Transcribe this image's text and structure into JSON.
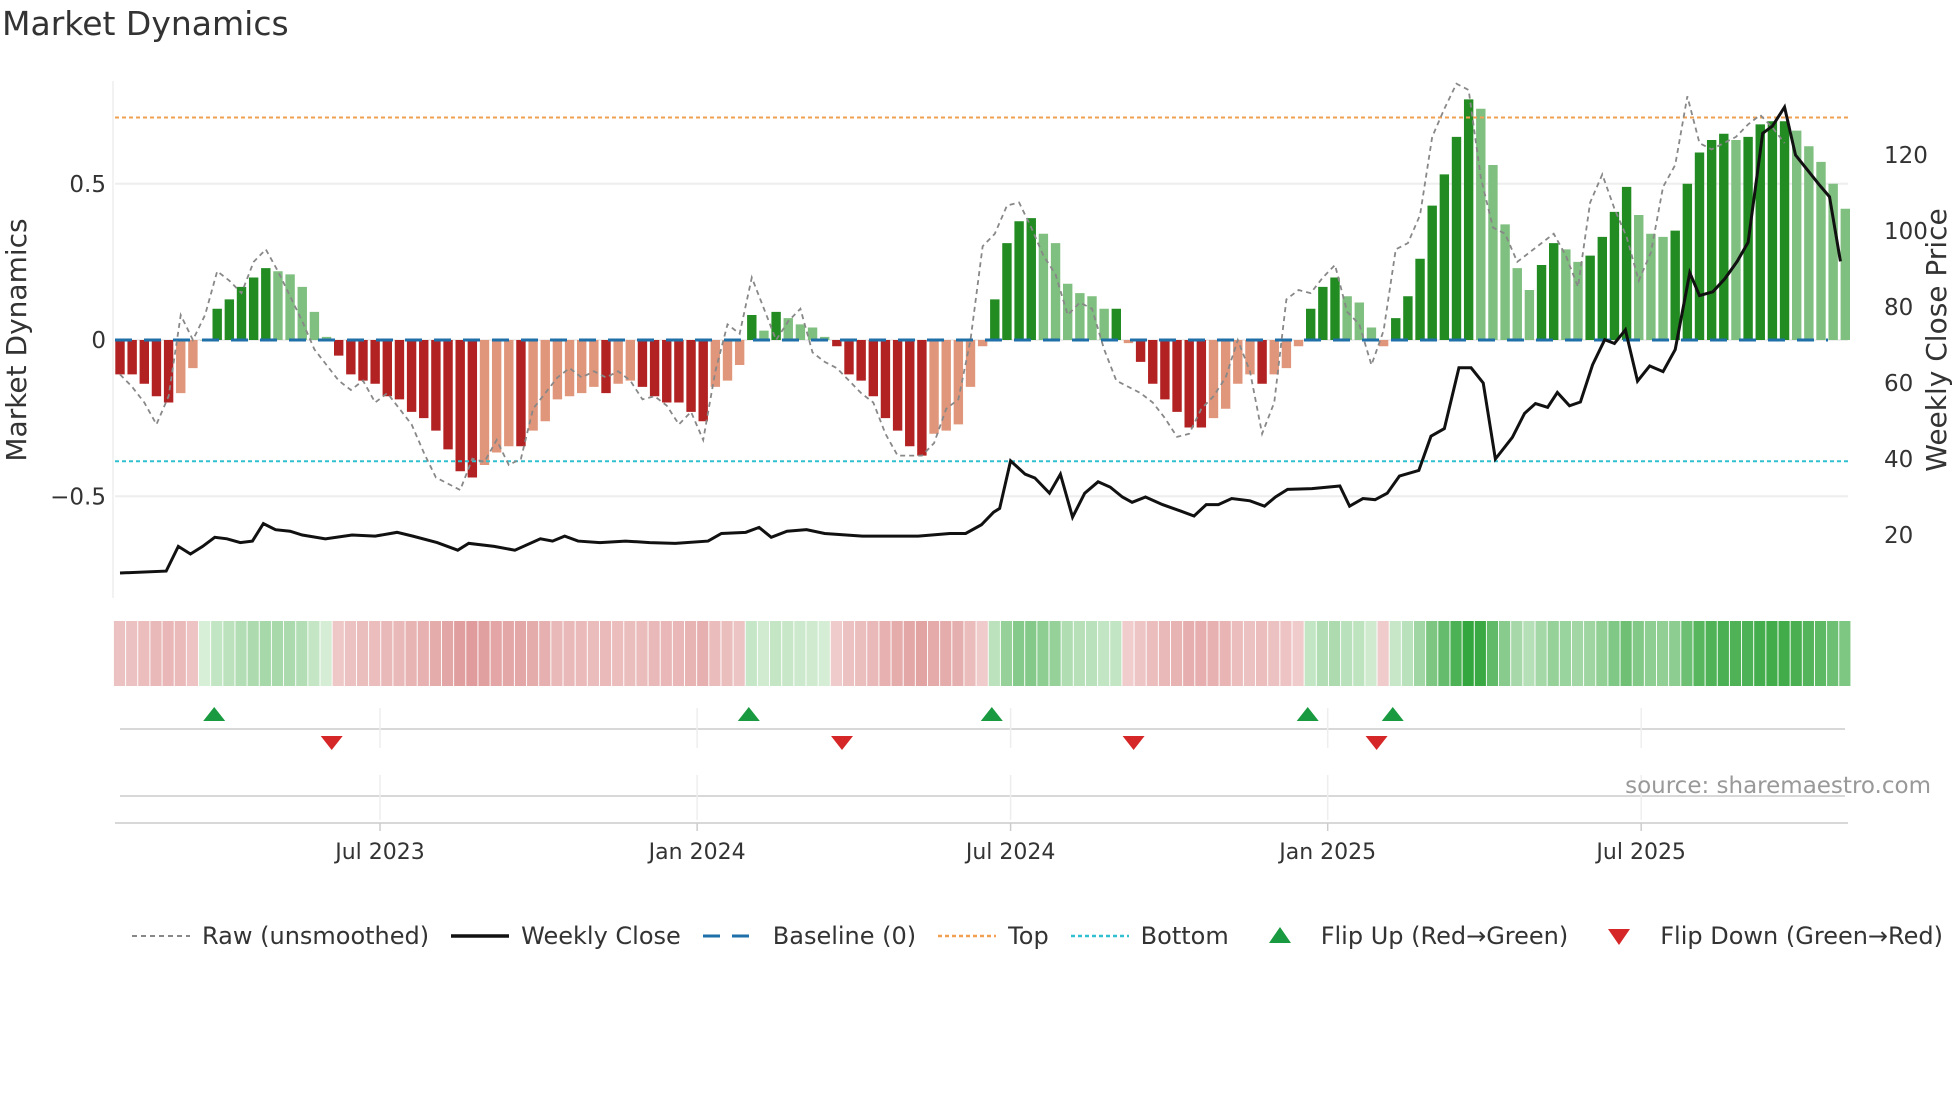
{
  "title": "Market Dynamics",
  "source": "source: sharemaestro.com",
  "legend": {
    "raw": "Raw (unsmoothed)",
    "close": "Weekly Close",
    "baseline": "Baseline (0)",
    "top": "Top",
    "bottom": "Bottom",
    "flip_up": "Flip Up (Red→Green)",
    "flip_down": "Flip Down (Green→Red)"
  },
  "colors": {
    "pos_strong": "#228b22",
    "pos_weak": "#7fbf7f",
    "neg_strong": "#b22222",
    "neg_weak": "#e0967a",
    "raw": "#888888",
    "close": "#111111",
    "baseline": "#1f6fa8",
    "top": "#f0a050",
    "bottom": "#30c0d0",
    "flip_up": "#1a9a40",
    "flip_down": "#d62728"
  },
  "chart_data": {
    "type": "bar",
    "title": "Market Dynamics",
    "ylabel": "Market Dynamics",
    "y2label": "Weekly Close Price",
    "xlabel": "",
    "x_unit": "weeks since start",
    "ylim": [
      -0.83,
      0.83
    ],
    "y2lim": [
      3.6,
      139.5
    ],
    "yticks": [
      {
        "v": 0.5,
        "label": "0.5"
      },
      {
        "v": 0,
        "label": "0"
      },
      {
        "v": -0.5,
        "label": "−0.5"
      }
    ],
    "y2ticks": [
      {
        "v": 120,
        "label": "120"
      },
      {
        "v": 100,
        "label": "100"
      },
      {
        "v": 80,
        "label": "80"
      },
      {
        "v": 60,
        "label": "60"
      },
      {
        "v": 40,
        "label": "40"
      },
      {
        "v": 20,
        "label": "20"
      }
    ],
    "xticks": [
      {
        "w": 21.4,
        "label": "Jul 2023"
      },
      {
        "w": 47.5,
        "label": "Jan 2024"
      },
      {
        "w": 73.3,
        "label": "Jul 2024"
      },
      {
        "w": 99.4,
        "label": "Jan 2025"
      },
      {
        "w": 125.2,
        "label": "Jul 2025"
      }
    ],
    "top_level": 0.712,
    "bottom_level": -0.388,
    "baseline": 0,
    "momentum": [
      -0.11,
      -0.11,
      -0.14,
      -0.18,
      -0.2,
      -0.17,
      -0.09,
      0,
      0.1,
      0.13,
      0.17,
      0.2,
      0.23,
      0.22,
      0.21,
      0.17,
      0.09,
      0.01,
      -0.05,
      -0.11,
      -0.13,
      -0.14,
      -0.18,
      -0.19,
      -0.23,
      -0.25,
      -0.29,
      -0.35,
      -0.42,
      -0.44,
      -0.4,
      -0.36,
      -0.34,
      -0.34,
      -0.29,
      -0.26,
      -0.19,
      -0.18,
      -0.17,
      -0.15,
      -0.17,
      -0.14,
      -0.13,
      -0.15,
      -0.18,
      -0.2,
      -0.2,
      -0.23,
      -0.26,
      -0.15,
      -0.13,
      -0.08,
      0.08,
      0.03,
      0.09,
      0.07,
      0.05,
      0.04,
      0.01,
      -0.02,
      -0.11,
      -0.13,
      -0.18,
      -0.25,
      -0.29,
      -0.34,
      -0.37,
      -0.3,
      -0.29,
      -0.27,
      -0.15,
      -0.02,
      0.13,
      0.31,
      0.38,
      0.39,
      0.34,
      0.31,
      0.18,
      0.15,
      0.14,
      0.1,
      0.1,
      -0.01,
      -0.07,
      -0.14,
      -0.19,
      -0.23,
      -0.28,
      -0.28,
      -0.25,
      -0.22,
      -0.14,
      -0.11,
      -0.14,
      -0.11,
      -0.09,
      -0.02,
      0.1,
      0.17,
      0.2,
      0.14,
      0.12,
      0.04,
      -0.02,
      0.07,
      0.14,
      0.26,
      0.43,
      0.53,
      0.65,
      0.77,
      0.74,
      0.56,
      0.37,
      0.23,
      0.16,
      0.24,
      0.31,
      0.29,
      0.25,
      0.27,
      0.33,
      0.41,
      0.49,
      0.4,
      0.34,
      0.33,
      0.35,
      0.5,
      0.6,
      0.64,
      0.66,
      0.64,
      0.65,
      0.69,
      0.7,
      0.7,
      0.67,
      0.62,
      0.57,
      0.5,
      0.42
    ],
    "raw": [
      -0.11,
      -0.15,
      -0.2,
      -0.27,
      -0.18,
      0.08,
      0,
      0.08,
      0.22,
      0.19,
      0.15,
      0.25,
      0.29,
      0.22,
      0.14,
      0.06,
      -0.03,
      -0.08,
      -0.13,
      -0.16,
      -0.13,
      -0.2,
      -0.17,
      -0.22,
      -0.27,
      -0.36,
      -0.44,
      -0.46,
      -0.48,
      -0.38,
      -0.39,
      -0.32,
      -0.4,
      -0.38,
      -0.22,
      -0.17,
      -0.12,
      -0.09,
      -0.12,
      -0.1,
      -0.12,
      -0.1,
      -0.13,
      -0.19,
      -0.18,
      -0.21,
      -0.27,
      -0.23,
      -0.32,
      -0.1,
      0.05,
      0.02,
      0.2,
      0.1,
      0,
      0.06,
      0.1,
      -0.04,
      -0.07,
      -0.09,
      -0.13,
      -0.17,
      -0.2,
      -0.3,
      -0.37,
      -0.37,
      -0.37,
      -0.33,
      -0.22,
      -0.19,
      0,
      0.3,
      0.34,
      0.43,
      0.44,
      0.36,
      0.27,
      0.21,
      0.08,
      0.12,
      0.1,
      -0.03,
      -0.13,
      -0.15,
      -0.17,
      -0.2,
      -0.25,
      -0.31,
      -0.3,
      -0.22,
      -0.18,
      -0.12,
      0,
      -0.1,
      -0.3,
      -0.2,
      0.13,
      0.16,
      0.15,
      0.2,
      0.24,
      0.09,
      0.05,
      -0.08,
      0.03,
      0.29,
      0.31,
      0.4,
      0.65,
      0.74,
      0.82,
      0.8,
      0.52,
      0.36,
      0.34,
      0.25,
      0.28,
      0.31,
      0.34,
      0.27,
      0.17,
      0.44,
      0.53,
      0.42,
      0.33,
      0.19,
      0.28,
      0.49,
      0.56,
      0.78,
      0.63,
      0.61,
      0.63,
      0.65,
      0.69,
      0.72,
      0.68,
      0.63
    ],
    "close": [
      [
        0,
        10
      ],
      [
        3.8,
        10.5
      ],
      [
        4.8,
        17
      ],
      [
        5.8,
        15
      ],
      [
        6.8,
        17
      ],
      [
        7.8,
        19.4
      ],
      [
        8.8,
        19
      ],
      [
        9.9,
        18
      ],
      [
        10.9,
        18.4
      ],
      [
        11.8,
        23
      ],
      [
        12.8,
        21.4
      ],
      [
        14,
        21
      ],
      [
        15,
        20
      ],
      [
        16.9,
        19
      ],
      [
        19.1,
        20
      ],
      [
        21,
        19.7
      ],
      [
        22.8,
        20.7
      ],
      [
        24.1,
        19.7
      ],
      [
        26.1,
        18
      ],
      [
        27.8,
        16
      ],
      [
        28.7,
        17.8
      ],
      [
        30.8,
        17
      ],
      [
        32.5,
        16
      ],
      [
        34.6,
        19
      ],
      [
        35.6,
        18.4
      ],
      [
        36.6,
        19.7
      ],
      [
        37.7,
        18.4
      ],
      [
        39.5,
        18
      ],
      [
        41.6,
        18.4
      ],
      [
        43.6,
        18
      ],
      [
        45.7,
        17.8
      ],
      [
        48.4,
        18.4
      ],
      [
        49.5,
        20.4
      ],
      [
        51.5,
        20.7
      ],
      [
        52.6,
        22
      ],
      [
        53.6,
        19.4
      ],
      [
        54.9,
        21
      ],
      [
        56.5,
        21.4
      ],
      [
        58,
        20.4
      ],
      [
        61.1,
        19.7
      ],
      [
        63.2,
        19.7
      ],
      [
        65.7,
        19.7
      ],
      [
        68.3,
        20.4
      ],
      [
        69.6,
        20.4
      ],
      [
        70.9,
        22.7
      ],
      [
        71.9,
        26
      ],
      [
        72.4,
        27
      ],
      [
        73.3,
        39.5
      ],
      [
        74.5,
        36
      ],
      [
        75.3,
        35
      ],
      [
        76.5,
        31
      ],
      [
        77.4,
        36
      ],
      [
        78.4,
        24.7
      ],
      [
        79.4,
        31
      ],
      [
        80.5,
        34
      ],
      [
        81.5,
        32.6
      ],
      [
        82.5,
        30
      ],
      [
        83.3,
        28.6
      ],
      [
        84.4,
        30
      ],
      [
        85.8,
        28
      ],
      [
        87.3,
        26.3
      ],
      [
        88.4,
        25
      ],
      [
        89.4,
        28
      ],
      [
        90.4,
        28
      ],
      [
        91.5,
        29.6
      ],
      [
        93,
        29
      ],
      [
        94.2,
        27.6
      ],
      [
        95.1,
        30
      ],
      [
        96.1,
        32
      ],
      [
        98.1,
        32.2
      ],
      [
        100.4,
        32.9
      ],
      [
        101.2,
        27.6
      ],
      [
        102.3,
        29.6
      ],
      [
        103.3,
        29.3
      ],
      [
        104.3,
        31
      ],
      [
        105.3,
        35.5
      ],
      [
        106.9,
        37
      ],
      [
        107.9,
        46
      ],
      [
        109,
        48
      ],
      [
        110.2,
        64
      ],
      [
        111.2,
        64
      ],
      [
        112.2,
        60
      ],
      [
        113.2,
        40
      ],
      [
        114.6,
        45.7
      ],
      [
        115.6,
        52
      ],
      [
        116.5,
        54.6
      ],
      [
        117.5,
        53.6
      ],
      [
        118.3,
        57.5
      ],
      [
        119.3,
        54
      ],
      [
        120.2,
        55
      ],
      [
        121.2,
        64.8
      ],
      [
        122.2,
        71.4
      ],
      [
        123,
        70.4
      ],
      [
        123.9,
        74
      ],
      [
        124.9,
        60.5
      ],
      [
        125.9,
        64.5
      ],
      [
        127,
        63
      ],
      [
        128,
        68.8
      ],
      [
        129.2,
        89
      ],
      [
        130,
        83
      ],
      [
        131.1,
        84
      ],
      [
        132.1,
        87.5
      ],
      [
        133.1,
        92
      ],
      [
        134,
        97
      ],
      [
        135.2,
        125.7
      ],
      [
        136,
        127.6
      ],
      [
        137,
        132.6
      ],
      [
        137.9,
        120
      ],
      [
        138.9,
        116
      ],
      [
        139.9,
        112
      ],
      [
        140.7,
        109
      ],
      [
        141.6,
        92
      ]
    ],
    "flip_up_weeks": [
      8,
      52,
      72,
      98,
      105
    ],
    "flip_down_weeks": [
      18,
      60,
      84,
      104
    ]
  }
}
